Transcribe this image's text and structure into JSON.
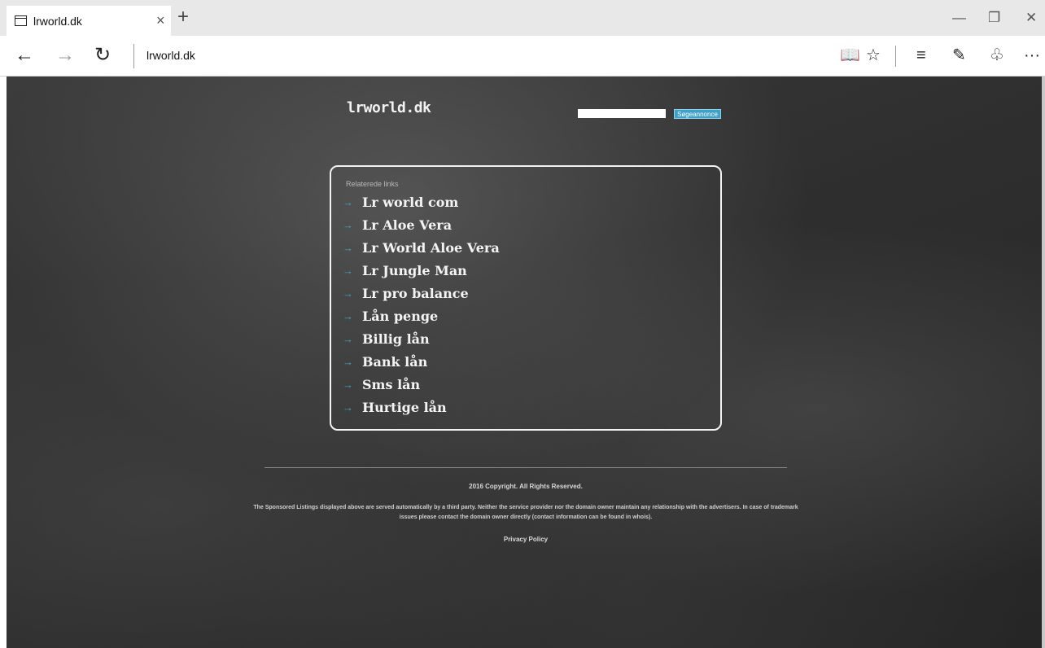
{
  "browser": {
    "tab_title": "lrworld.dk",
    "tab_close": "×",
    "new_tab": "+",
    "address": "lrworld.dk",
    "more": "···"
  },
  "site": {
    "logo": "lrworld.dk",
    "search_placeholder": "",
    "search_button": "Søgeannonce"
  },
  "related": {
    "heading": "Relaterede links",
    "links": [
      "Lr world com",
      "Lr Aloe Vera",
      "Lr World Aloe Vera",
      "Lr Jungle Man",
      "Lr pro balance",
      "Lån penge",
      "Billig lån",
      "Bank lån",
      "Sms lån",
      "Hurtige lån"
    ]
  },
  "footer": {
    "copyright": "2016 Copyright. All Rights Reserved.",
    "disclaimer": "The Sponsored Listings displayed above are served automatically by a third party. Neither the service provider nor the domain owner maintain any relationship with the advertisers. In case of trademark issues please contact the domain owner directly (contact information can be found in whois).",
    "privacy": "Privacy Policy"
  },
  "colors": {
    "accent": "#3fa1c8",
    "chalkboard": "#333333"
  }
}
